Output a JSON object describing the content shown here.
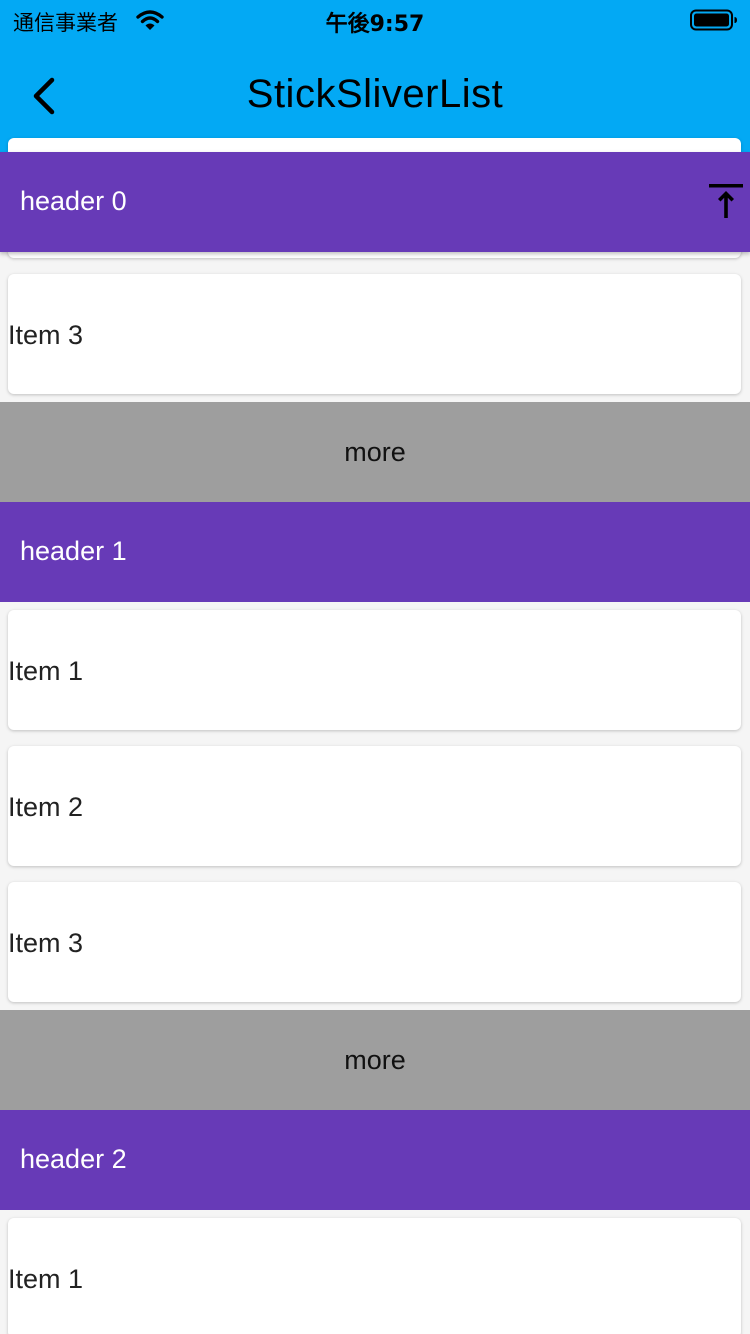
{
  "status_bar": {
    "carrier": "通信事業者",
    "time": "午後9:57",
    "wifi_icon": "wifi-icon",
    "battery_icon": "battery-full-icon"
  },
  "app_bar": {
    "title": "StickSliverList",
    "back_icon": "chevron-left-icon",
    "background": "#03a9f4"
  },
  "colors": {
    "header_bg": "#673ab7",
    "more_bg": "#9e9e9e",
    "card_bg": "#ffffff",
    "page_bg": "#f5f5f5"
  },
  "sections": [
    {
      "header": "header 0",
      "scroll_to_top_icon": "vertical-align-top-icon",
      "items": [
        "Item 3"
      ],
      "more": "more"
    },
    {
      "header": "header 1",
      "items": [
        "Item 1",
        "Item 2",
        "Item 3"
      ],
      "more": "more"
    },
    {
      "header": "header 2",
      "items": [
        "Item 1"
      ]
    }
  ]
}
